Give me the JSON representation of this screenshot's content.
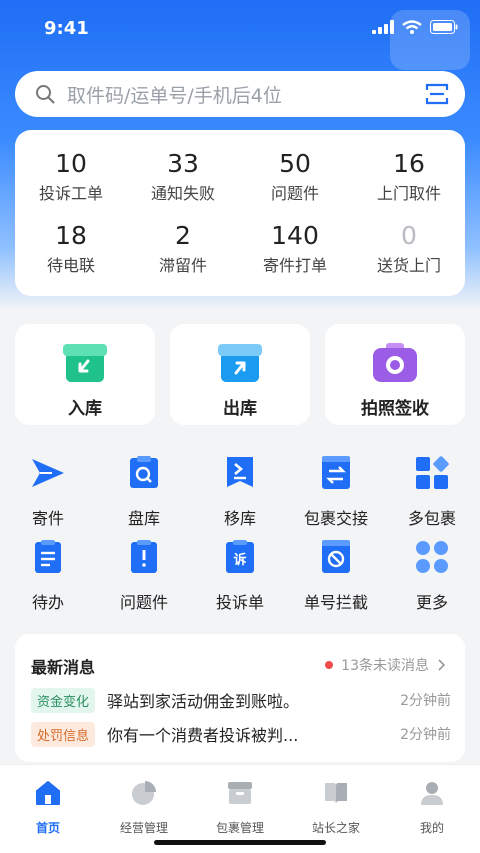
{
  "status_bar": {
    "time": "9:41"
  },
  "search": {
    "placeholder": "取件码/运单号/手机后4位"
  },
  "stats": [
    {
      "value": "10",
      "label": "投诉工单"
    },
    {
      "value": "33",
      "label": "通知失败"
    },
    {
      "value": "50",
      "label": "问题件"
    },
    {
      "value": "16",
      "label": "上门取件"
    },
    {
      "value": "18",
      "label": "待电联"
    },
    {
      "value": "2",
      "label": "滞留件"
    },
    {
      "value": "140",
      "label": "寄件打单"
    },
    {
      "value": "0",
      "label": "送货上门"
    }
  ],
  "main_actions": [
    {
      "label": "入库",
      "icon": "inbound-box-icon",
      "color": "#1fc28a"
    },
    {
      "label": "出库",
      "icon": "outbound-box-icon",
      "color": "#1c9cf0"
    },
    {
      "label": "拍照签收",
      "icon": "camera-icon",
      "color": "#9b5de5"
    }
  ],
  "grid_items": [
    {
      "label": "寄件",
      "icon": "send-icon"
    },
    {
      "label": "盘库",
      "icon": "inventory-icon"
    },
    {
      "label": "移库",
      "icon": "move-icon"
    },
    {
      "label": "包裹交接",
      "icon": "handover-icon"
    },
    {
      "label": "多包裹",
      "icon": "multi-package-icon"
    },
    {
      "label": "待办",
      "icon": "todo-icon"
    },
    {
      "label": "问题件",
      "icon": "problem-icon"
    },
    {
      "label": "投诉单",
      "icon": "complaint-icon"
    },
    {
      "label": "单号拦截",
      "icon": "intercept-icon"
    },
    {
      "label": "更多",
      "icon": "more-icon"
    }
  ],
  "news": {
    "title": "最新消息",
    "unread": "13条未读消息",
    "items": [
      {
        "tag": "资金变化",
        "text": "驿站到家活动佣金到账啦。",
        "time": "2分钟前"
      },
      {
        "tag": "处罚信息",
        "text": "你有一个消费者投诉被判...",
        "time": "2分钟前"
      }
    ]
  },
  "tabs": [
    {
      "label": "首页",
      "icon": "home-icon"
    },
    {
      "label": "经营管理",
      "icon": "pie-chart-icon"
    },
    {
      "label": "包裹管理",
      "icon": "package-icon"
    },
    {
      "label": "站长之家",
      "icon": "book-icon"
    },
    {
      "label": "我的",
      "icon": "user-icon"
    }
  ],
  "colors": {
    "primary": "#1f6ef5",
    "accent_red": "#f24b4b"
  }
}
